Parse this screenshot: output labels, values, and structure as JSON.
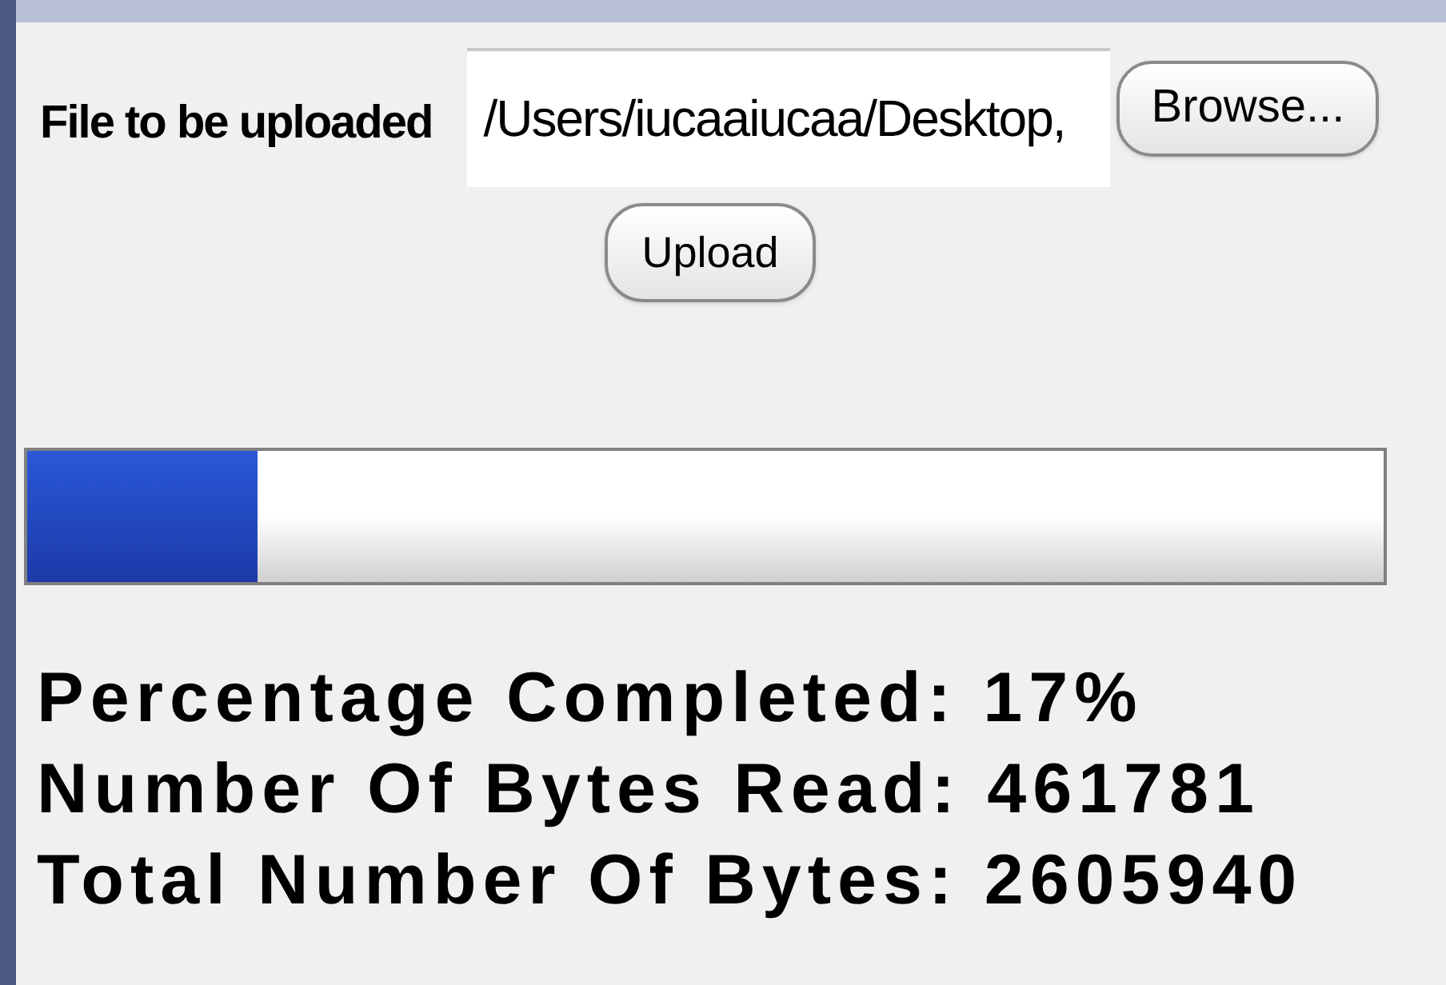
{
  "upload_form": {
    "label": "File to be uploaded",
    "file_field": {
      "value": "/Users/iucaaiucaa/Desktop,"
    },
    "browse_button": "Browse...",
    "upload_button": "Upload"
  },
  "progress": {
    "level": 0.17
  },
  "stats": [
    "Percentage Completed: 17%",
    "Number Of Bytes Read: 461781",
    "Total Number Of Bytes: 2605940"
  ]
}
